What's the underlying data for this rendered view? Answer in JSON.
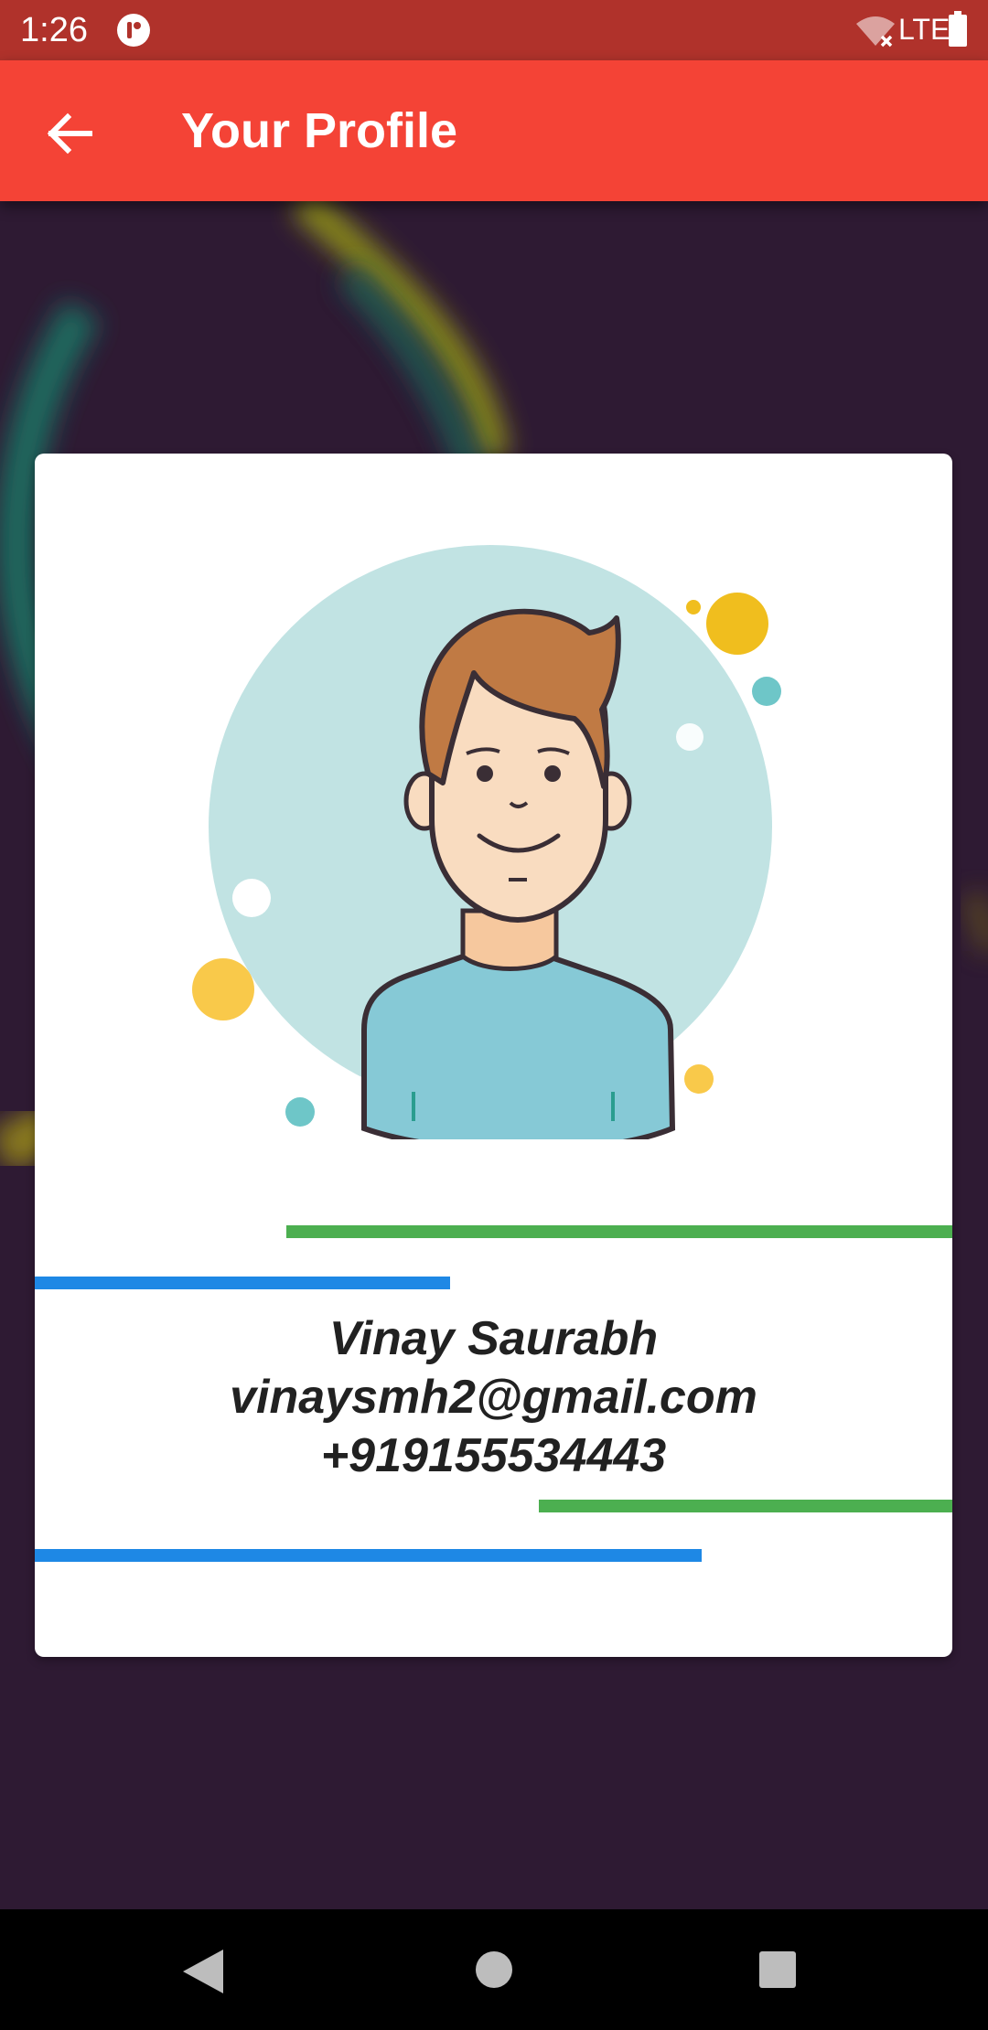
{
  "status_bar": {
    "time": "1:26",
    "network": "LTE",
    "app_icon": "notification-app-icon",
    "wifi_icon": "wifi-off-icon",
    "battery_icon": "battery-full-icon",
    "background_color": "#b0322b"
  },
  "app_bar": {
    "title": "Your Profile",
    "back_icon": "arrow-left-icon",
    "background_color": "#f44336"
  },
  "profile": {
    "name": "Vinay Saurabh",
    "email": "vinaysmh2@gmail.com",
    "phone": "+919155534443",
    "avatar_icon": "male-avatar-illustration"
  },
  "colors": {
    "page_background": "#2e1a33",
    "card_background": "#ffffff",
    "accent_green": "#4caf50",
    "accent_blue": "#1e88e5",
    "text": "#212121"
  },
  "nav_bar": {
    "back_icon": "triangle-back-icon",
    "home_icon": "circle-home-icon",
    "recents_icon": "square-recents-icon"
  }
}
